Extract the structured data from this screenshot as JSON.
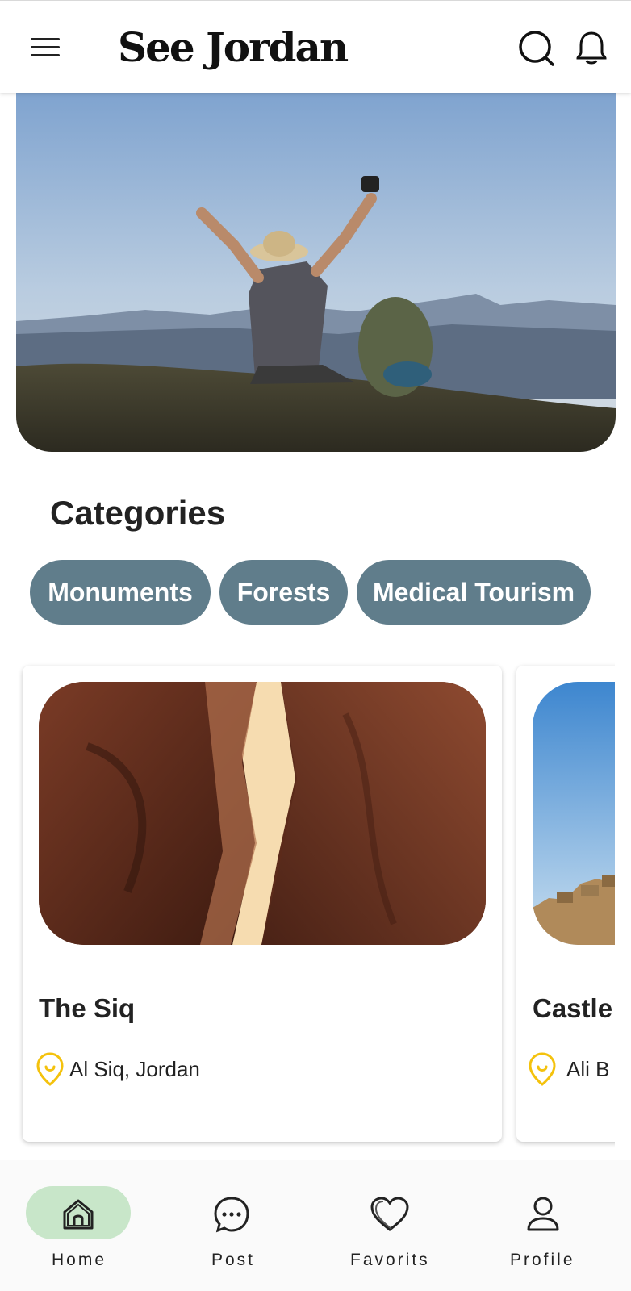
{
  "header": {
    "title": "See Jordan",
    "menu_icon": "hamburger-menu-icon",
    "search_icon": "search-icon",
    "notification_icon": "bell-icon"
  },
  "hero": {
    "image": "traveler-raising-arms-on-mountain-photo"
  },
  "categories": {
    "title": "Categories",
    "items": [
      {
        "label": "Monuments"
      },
      {
        "label": "Forests"
      },
      {
        "label": "Medical Tourism"
      }
    ]
  },
  "places": [
    {
      "name": "The Siq",
      "location": "Al Siq, Jordan",
      "image": "siq-canyon-photo"
    },
    {
      "name": "Castle",
      "location": "Ali B",
      "image": "castle-ruins-photo"
    }
  ],
  "bottom_nav": {
    "items": [
      {
        "label": "Home",
        "icon": "home-icon",
        "active": true
      },
      {
        "label": "Post",
        "icon": "chat-bubble-icon",
        "active": false
      },
      {
        "label": "Favorits",
        "icon": "heart-icon",
        "active": false
      },
      {
        "label": "Profile",
        "icon": "person-icon",
        "active": false
      }
    ]
  },
  "colors": {
    "chip_background": "#607d8b",
    "active_nav_pill": "#c8e6c9",
    "location_pin": "#f4c20d"
  }
}
